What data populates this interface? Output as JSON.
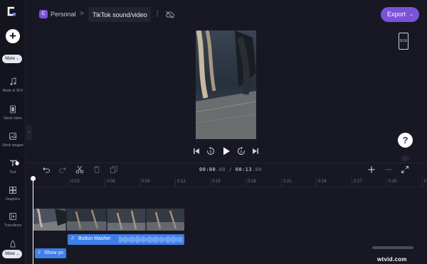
{
  "app": {
    "brand_letter": "C",
    "accent": "#7c52d8",
    "clip_blue": "#3e7fea"
  },
  "sidebar": {
    "add_icon": "+",
    "more_top": "More",
    "items": [
      {
        "label": "Music & SFX",
        "icon": "music-note-icon"
      },
      {
        "label": "Stock video",
        "icon": "film-icon"
      },
      {
        "label": "Stock images",
        "icon": "image-icon"
      },
      {
        "label": "Text",
        "icon": "text-icon"
      },
      {
        "label": "Graphics",
        "icon": "shapes-icon"
      },
      {
        "label": "Transitions",
        "icon": "transition-icon"
      }
    ],
    "more_bottom": "More",
    "collapse_glyph": "›"
  },
  "header": {
    "workspace_initial": "C",
    "workspace": "Personal",
    "separator": ">",
    "project_title": "TikTok sound/video",
    "kebab": "⋮",
    "export_label": "Export",
    "export_chevron": "⌄"
  },
  "preview": {
    "aspect_ratio": "9:16",
    "help": "?",
    "help_chevron": "⌄"
  },
  "timeline": {
    "timecode_current": "00:00",
    "timecode_current_frames": ".00",
    "timecode_sep": " / ",
    "timecode_total": "00:13",
    "timecode_total_frames": ".00",
    "ticks": [
      "0:03",
      "0:06",
      "0:09",
      "0:12",
      "0:15",
      "0:18",
      "0:21",
      "0:24",
      "0:27",
      "0:30",
      "0:33"
    ],
    "audio_clip_label": "Button Masher",
    "text_clip_label": "Show yo",
    "note_glyph": "♫"
  },
  "watermark": "wtvid.com"
}
